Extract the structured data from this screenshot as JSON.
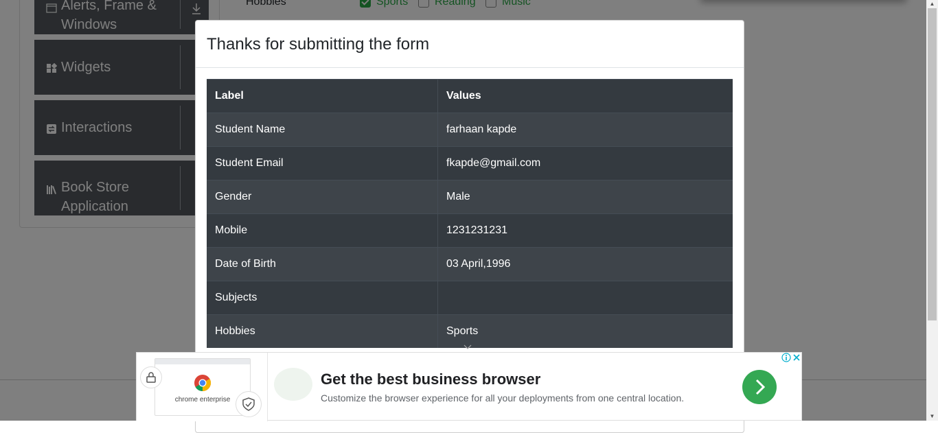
{
  "background": {
    "sidebar_groups": [
      {
        "label": "Alerts, Frame &",
        "label2": "Windows",
        "icon": "window-icon"
      },
      {
        "label": "Widgets",
        "icon": "widgets-icon"
      },
      {
        "label": "Interactions",
        "icon": "interactions-icon"
      },
      {
        "label": "Book Store",
        "label2": "Application",
        "icon": "books-icon"
      }
    ],
    "form": {
      "hobbies_label": "Hobbies",
      "hobbies": [
        {
          "label": "Sports",
          "checked": true
        },
        {
          "label": "Reading",
          "checked": false
        },
        {
          "label": "Music",
          "checked": false
        }
      ]
    }
  },
  "modal": {
    "title": "Thanks for submitting the form",
    "columns": [
      "Label",
      "Values"
    ],
    "rows": [
      {
        "label": "Student Name",
        "value": "farhaan kapde"
      },
      {
        "label": "Student Email",
        "value": "fkapde@gmail.com"
      },
      {
        "label": "Gender",
        "value": "Male"
      },
      {
        "label": "Mobile",
        "value": "1231231231"
      },
      {
        "label": "Date of Birth",
        "value": "03 April,1996"
      },
      {
        "label": "Subjects",
        "value": ""
      },
      {
        "label": "Hobbies",
        "value": "Sports"
      }
    ]
  },
  "ad": {
    "headline": "Get the best business browser",
    "subtext": "Customize the browser experience for all your deployments from one central location.",
    "brand_text": "chrome enterprise",
    "accent": "#34a853"
  }
}
